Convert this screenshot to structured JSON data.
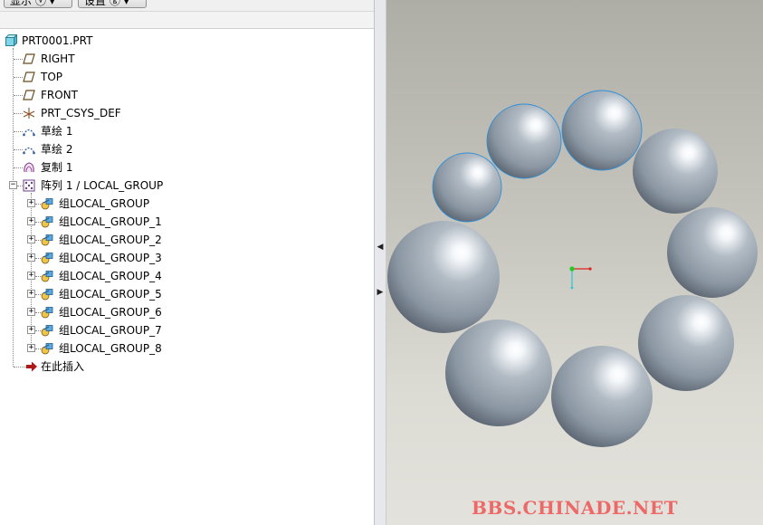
{
  "toolbar": {
    "show_label": "显示 ⓥ ▾",
    "settings_label": "设置 ⓖ ▾"
  },
  "tree": {
    "root": "PRT0001.PRT",
    "items": [
      {
        "label": "RIGHT",
        "icon": "datum-plane-icon"
      },
      {
        "label": "TOP",
        "icon": "datum-plane-icon"
      },
      {
        "label": "FRONT",
        "icon": "datum-plane-icon"
      },
      {
        "label": "PRT_CSYS_DEF",
        "icon": "coordinate-system-icon"
      },
      {
        "label": "草绘 1",
        "icon": "sketch-icon"
      },
      {
        "label": "草绘 2",
        "icon": "sketch-icon"
      },
      {
        "label": "复制 1",
        "icon": "copy-feature-icon"
      }
    ],
    "pattern": {
      "label": "阵列 1 / LOCAL_GROUP",
      "expand_symbol": "−",
      "children": [
        "组LOCAL_GROUP",
        "组LOCAL_GROUP_1",
        "组LOCAL_GROUP_2",
        "组LOCAL_GROUP_3",
        "组LOCAL_GROUP_4",
        "组LOCAL_GROUP_5",
        "组LOCAL_GROUP_6",
        "组LOCAL_GROUP_7",
        "组LOCAL_GROUP_8"
      ],
      "child_expand_symbol": "+"
    },
    "insert_here": "在此插入"
  },
  "splitter": {
    "collapse_arrow": "◀",
    "expand_arrow": "▶"
  },
  "watermark": "BBS.CHINADE.NET",
  "colors": {
    "sphere_base": "#8d98a3",
    "sphere_highlight": "#ffffff",
    "selection_edge": "#2f8fd8",
    "axis_x": "#e02020",
    "axis_y": "#22cc22",
    "axis_z": "#30c8d8"
  }
}
